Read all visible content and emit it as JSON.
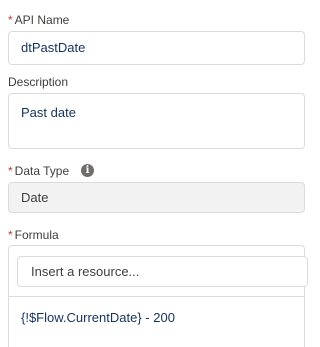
{
  "fields": {
    "api_name": {
      "required_mark": "*",
      "label": "API Name",
      "value": "dtPastDate"
    },
    "description": {
      "label": "Description",
      "value": "Past date"
    },
    "data_type": {
      "required_mark": "*",
      "label": "Data Type",
      "info_icon": "info-icon",
      "value": "Date"
    },
    "formula": {
      "required_mark": "*",
      "label": "Formula",
      "resource_placeholder": "Insert a resource...",
      "expression": "{!$Flow.CurrentDate} - 200"
    }
  },
  "colors": {
    "required": "#c23934",
    "border": "#dddbda",
    "readonly_bg": "#f3f2f2",
    "value_text": "#16325c"
  }
}
